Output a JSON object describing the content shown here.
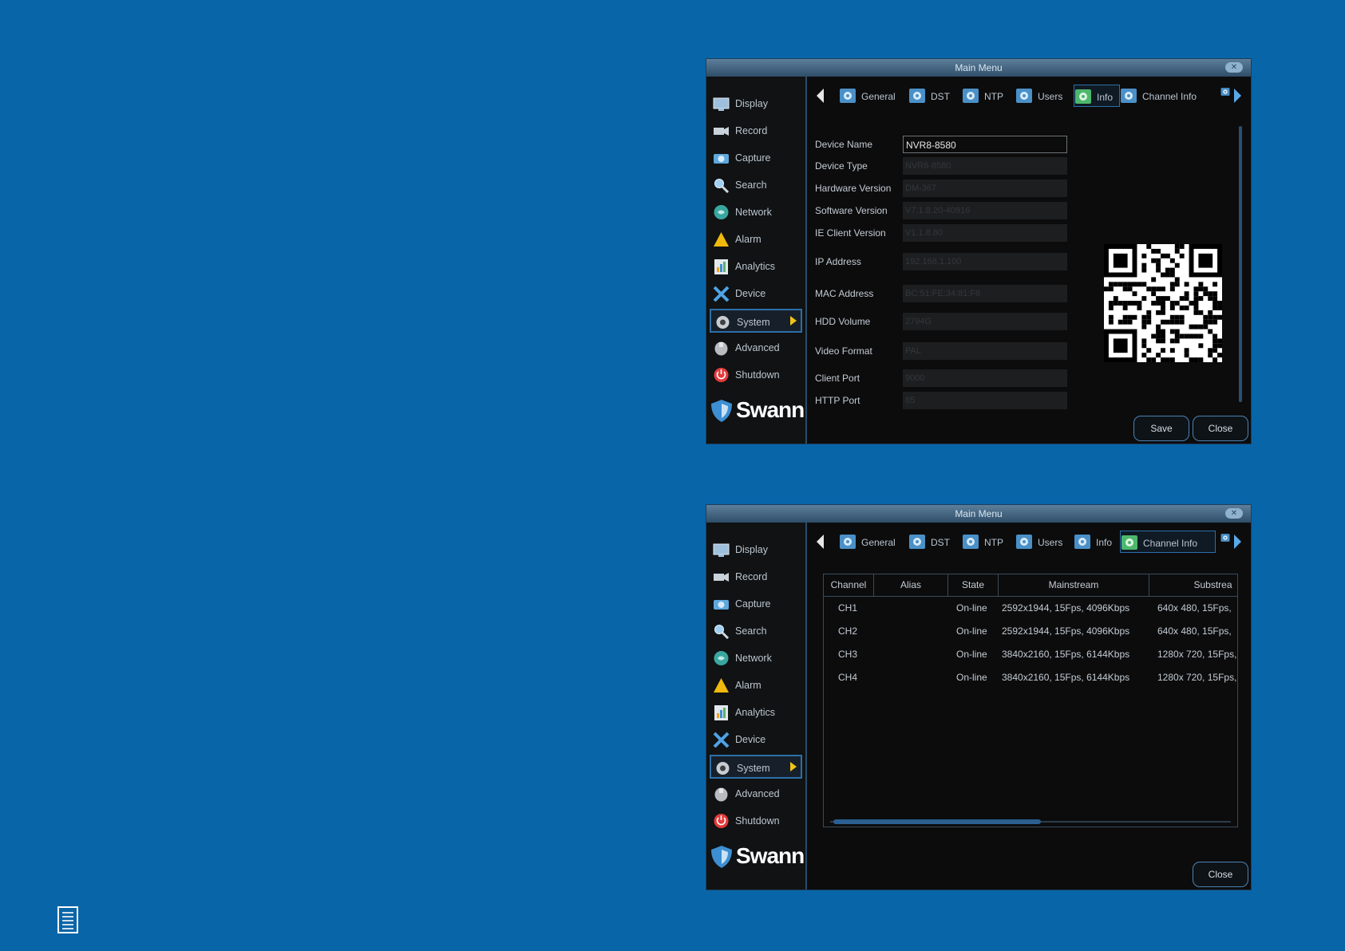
{
  "windows": [
    {
      "title": "Main Menu",
      "sidebar": [
        {
          "label": "Display",
          "icon": "display-icon"
        },
        {
          "label": "Record",
          "icon": "record-icon"
        },
        {
          "label": "Capture",
          "icon": "capture-icon"
        },
        {
          "label": "Search",
          "icon": "search-icon"
        },
        {
          "label": "Network",
          "icon": "network-icon"
        },
        {
          "label": "Alarm",
          "icon": "alarm-icon"
        },
        {
          "label": "Analytics",
          "icon": "analytics-icon"
        },
        {
          "label": "Device",
          "icon": "device-icon"
        },
        {
          "label": "System",
          "icon": "system-gear-icon",
          "active": true
        },
        {
          "label": "Advanced",
          "icon": "advanced-icon"
        },
        {
          "label": "Shutdown",
          "icon": "shutdown-icon"
        }
      ],
      "tabs": [
        "General",
        "DST",
        "NTP",
        "Users",
        "Info",
        "Channel Info"
      ],
      "active_tab": "Info",
      "fields": [
        {
          "label": "Device Name",
          "value": "NVR8-8580",
          "editable": true
        },
        {
          "label": "Device Type",
          "value": "NVR8-8580"
        },
        {
          "label": "Hardware Version",
          "value": "DM-367"
        },
        {
          "label": "Software Version",
          "value": "V7.1.8.20-40916"
        },
        {
          "label": "IE Client Version",
          "value": "V1.1.8.80"
        },
        {
          "label": "IP Address",
          "value": "192.168.1.100"
        },
        {
          "label": "MAC Address",
          "value": "BC:51:FE:34:81:F8"
        },
        {
          "label": "HDD Volume",
          "value": "2794G"
        },
        {
          "label": "Video Format",
          "value": "PAL"
        },
        {
          "label": "Client Port",
          "value": "9000"
        },
        {
          "label": "HTTP Port",
          "value": "85"
        }
      ],
      "buttons": {
        "save": "Save",
        "close": "Close"
      }
    },
    {
      "title": "Main Menu",
      "sidebar": [
        {
          "label": "Display",
          "icon": "display-icon"
        },
        {
          "label": "Record",
          "icon": "record-icon"
        },
        {
          "label": "Capture",
          "icon": "capture-icon"
        },
        {
          "label": "Search",
          "icon": "search-icon"
        },
        {
          "label": "Network",
          "icon": "network-icon"
        },
        {
          "label": "Alarm",
          "icon": "alarm-icon"
        },
        {
          "label": "Analytics",
          "icon": "analytics-icon"
        },
        {
          "label": "Device",
          "icon": "device-icon"
        },
        {
          "label": "System",
          "icon": "system-gear-icon",
          "active": true
        },
        {
          "label": "Advanced",
          "icon": "advanced-icon"
        },
        {
          "label": "Shutdown",
          "icon": "shutdown-icon"
        }
      ],
      "tabs": [
        "General",
        "DST",
        "NTP",
        "Users",
        "Info",
        "Channel Info"
      ],
      "active_tab": "Channel Info",
      "table": {
        "columns": [
          "Channel",
          "Alias",
          "State",
          "Mainstream",
          "Substrea"
        ],
        "rows": [
          [
            "CH1",
            "",
            "On-line",
            "2592x1944, 15Fps, 4096Kbps",
            "640x 480, 15Fps,"
          ],
          [
            "CH2",
            "",
            "On-line",
            "2592x1944, 15Fps, 4096Kbps",
            "640x 480, 15Fps,"
          ],
          [
            "CH3",
            "",
            "On-line",
            "3840x2160, 15Fps, 6144Kbps",
            "1280x 720, 15Fps,"
          ],
          [
            "CH4",
            "",
            "On-line",
            "3840x2160, 15Fps, 6144Kbps",
            "1280x 720, 15Fps,"
          ]
        ]
      },
      "buttons": {
        "close": "Close"
      }
    }
  ],
  "brand": "Swann",
  "colors": {
    "page_bg": "#0865a8",
    "accent": "#2d6fa8",
    "panel_bg": "#0c0c0d"
  }
}
